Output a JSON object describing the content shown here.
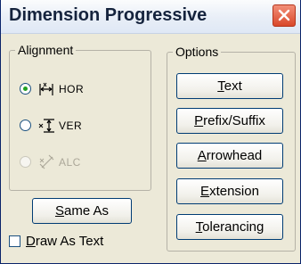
{
  "window": {
    "title": "Dimension Progressive",
    "close_icon": "close-icon"
  },
  "alignment": {
    "legend": "Alignment",
    "options": [
      {
        "label": "HOR",
        "icon": "horizontal-dimension-icon",
        "checked": true,
        "enabled": true
      },
      {
        "label": "VER",
        "icon": "vertical-dimension-icon",
        "checked": false,
        "enabled": true
      },
      {
        "label": "ALC",
        "icon": "aligned-dimension-icon",
        "checked": false,
        "enabled": false
      }
    ]
  },
  "options": {
    "legend": "Options",
    "buttons": [
      {
        "mnemonic": "T",
        "rest": "ext"
      },
      {
        "mnemonic": "P",
        "rest": "refix/Suffix"
      },
      {
        "mnemonic": "A",
        "rest": "rrowhead"
      },
      {
        "mnemonic": "E",
        "rest": "xtension"
      },
      {
        "mnemonic": "T",
        "rest": "olerancing"
      }
    ]
  },
  "same_as": {
    "mnemonic": "S",
    "rest": "ame As"
  },
  "draw_as_text": {
    "mnemonic": "D",
    "rest": "raw As Text",
    "checked": false
  }
}
